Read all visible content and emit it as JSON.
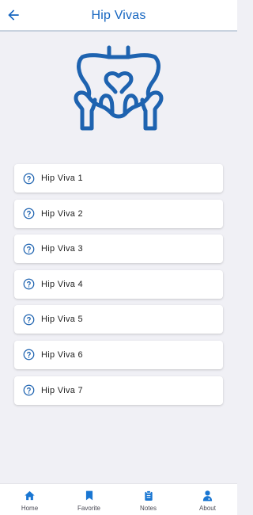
{
  "header": {
    "title": "Hip Vivas",
    "back_icon": "arrow-left-icon"
  },
  "hero": {
    "icon": "pelvis-icon"
  },
  "items": [
    {
      "label": "Hip Viva 1",
      "icon": "question-circle-icon"
    },
    {
      "label": "Hip Viva 2",
      "icon": "question-circle-icon"
    },
    {
      "label": "Hip Viva 3",
      "icon": "question-circle-icon"
    },
    {
      "label": "Hip Viva 4",
      "icon": "question-circle-icon"
    },
    {
      "label": "Hip Viva 5",
      "icon": "question-circle-icon"
    },
    {
      "label": "Hip Viva 6",
      "icon": "question-circle-icon"
    },
    {
      "label": "Hip Viva 7",
      "icon": "question-circle-icon"
    }
  ],
  "bottom_nav": [
    {
      "label": "Home",
      "icon": "home-icon"
    },
    {
      "label": "Favorite",
      "icon": "bookmark-icon"
    },
    {
      "label": "Notes",
      "icon": "clipboard-icon"
    },
    {
      "label": "About",
      "icon": "doctor-icon"
    }
  ],
  "colors": {
    "accent": "#1565c0",
    "background": "#f0f0f5",
    "card": "#ffffff"
  }
}
